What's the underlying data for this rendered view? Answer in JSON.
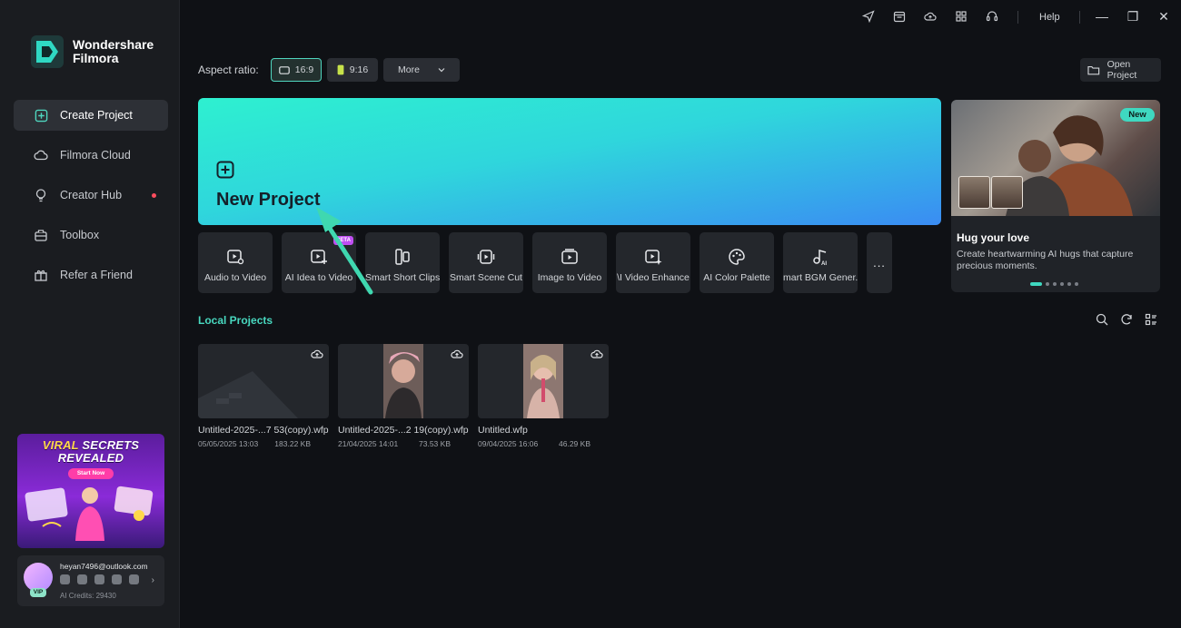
{
  "app": {
    "name_line1": "Wondershare",
    "name_line2": "Filmora"
  },
  "sidebar": {
    "items": [
      {
        "label": "Create Project"
      },
      {
        "label": "Filmora Cloud"
      },
      {
        "label": "Creator Hub"
      },
      {
        "label": "Toolbox"
      },
      {
        "label": "Refer a Friend"
      }
    ]
  },
  "promo": {
    "title_part1": "VIRAL",
    "title_part2": "SECRETS",
    "title_line2": "REVEALED",
    "button": "Start Now"
  },
  "user": {
    "email": "heyan7496@outlook.com",
    "vip": "VIP",
    "credits": "AI Credits: 29430"
  },
  "titlebar": {
    "help": "Help",
    "minimize": "—",
    "maximize": "❐",
    "close": "✕"
  },
  "aspect": {
    "label": "Aspect ratio:",
    "opt1": "16:9",
    "opt2": "9:16",
    "more": "More"
  },
  "open_project": "Open Project",
  "new_project": {
    "label": "New Project"
  },
  "tiles": [
    {
      "label": "Audio to Video"
    },
    {
      "label": "AI Idea to Video",
      "badge": "BETA"
    },
    {
      "label": "Smart Short Clips"
    },
    {
      "label": "Smart Scene Cut"
    },
    {
      "label": "Image to Video"
    },
    {
      "label": "\\I Video Enhance"
    },
    {
      "label": "AI Color Palette"
    },
    {
      "label": "mart BGM Gener."
    }
  ],
  "tiles_more": "...",
  "news": {
    "badge": "New",
    "title": "Hug your love",
    "desc": "Create heartwarming AI hugs that capture precious moments."
  },
  "local": {
    "title": "Local Projects"
  },
  "projects": [
    {
      "name": "Untitled-2025-...7 53(copy).wfp",
      "date": "05/05/2025 13:03",
      "size": "183.22 KB"
    },
    {
      "name": "Untitled-2025-...2 19(copy).wfp",
      "date": "21/04/2025 14:01",
      "size": "73.53 KB"
    },
    {
      "name": "Untitled.wfp",
      "date": "09/04/2025 16:06",
      "size": "46.29 KB"
    }
  ],
  "colors": {
    "accent": "#48d8bf",
    "sidebar_bg": "#1a1c20",
    "page_bg": "#0f1115",
    "alert_dot": "#ff4d5e"
  }
}
